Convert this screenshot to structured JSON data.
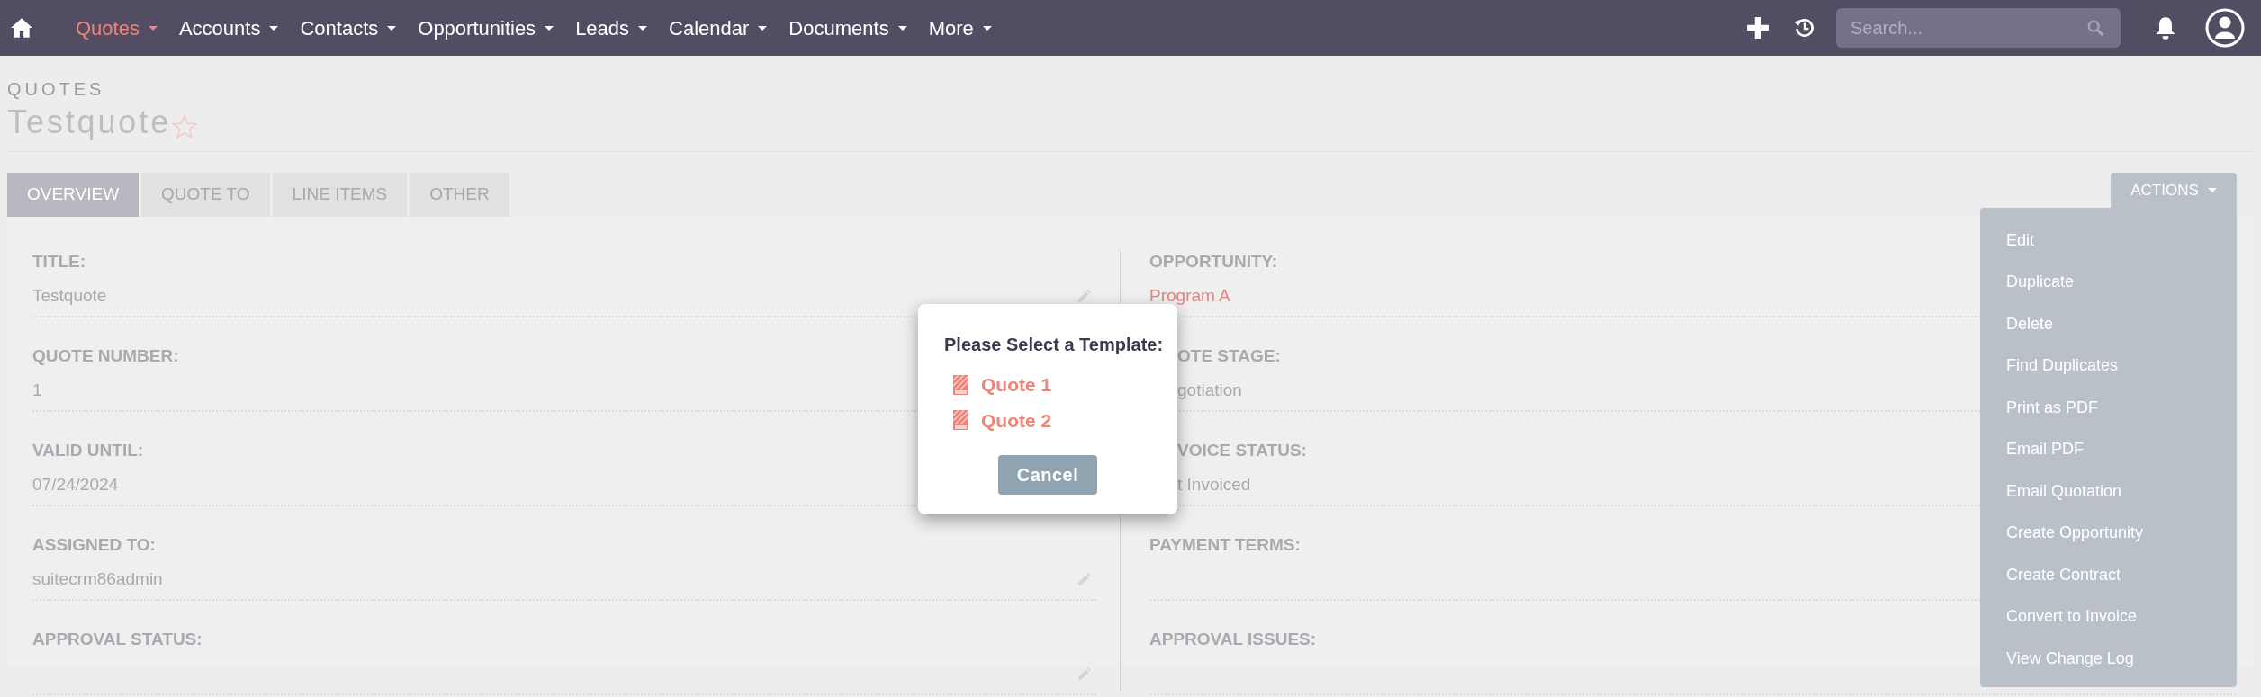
{
  "nav": {
    "items": [
      {
        "label": "Quotes",
        "selected": true
      },
      {
        "label": "Accounts",
        "selected": false
      },
      {
        "label": "Contacts",
        "selected": false
      },
      {
        "label": "Opportunities",
        "selected": false
      },
      {
        "label": "Leads",
        "selected": false
      },
      {
        "label": "Calendar",
        "selected": false
      },
      {
        "label": "Documents",
        "selected": false
      },
      {
        "label": "More",
        "selected": false
      }
    ],
    "search": {
      "placeholder": "Search..."
    }
  },
  "header": {
    "module": "QUOTES",
    "title": "Testquote",
    "favorite": false
  },
  "tabs": [
    {
      "label": "OVERVIEW",
      "selected": true
    },
    {
      "label": "QUOTE TO",
      "selected": false
    },
    {
      "label": "LINE ITEMS",
      "selected": false
    },
    {
      "label": "OTHER",
      "selected": false
    }
  ],
  "actions": {
    "label": "ACTIONS",
    "items": [
      "Edit",
      "Duplicate",
      "Delete",
      "Find Duplicates",
      "Print as PDF",
      "Email PDF",
      "Email Quotation",
      "Create Opportunity",
      "Create Contract",
      "Convert to Invoice",
      "View Change Log"
    ]
  },
  "left_fields": [
    {
      "label": "TITLE:",
      "value": "Testquote",
      "editable": true
    },
    {
      "label": "QUOTE NUMBER:",
      "value": "1"
    },
    {
      "label": "VALID UNTIL:",
      "value": "07/24/2024"
    },
    {
      "label": "ASSIGNED TO:",
      "value": "suitecrm86admin",
      "editable": true
    },
    {
      "label": "APPROVAL STATUS:",
      "editable": true
    }
  ],
  "right_fields": [
    {
      "label": "OPPORTUNITY:",
      "value": "Program A",
      "link": true,
      "covered": false
    },
    {
      "label": "OTE STAGE:",
      "value": "gotiation",
      "link": false,
      "covered": true
    },
    {
      "label": "VOICE STATUS:",
      "value": "t Invoiced",
      "link": false,
      "covered": true
    },
    {
      "label": "PAYMENT TERMS:",
      "covered": false
    },
    {
      "label": "APPROVAL ISSUES:",
      "covered": false
    }
  ],
  "dialog": {
    "title": "Please Select a Template:",
    "templates": [
      "Quote 1",
      "Quote 2"
    ],
    "cancel": "Cancel"
  }
}
